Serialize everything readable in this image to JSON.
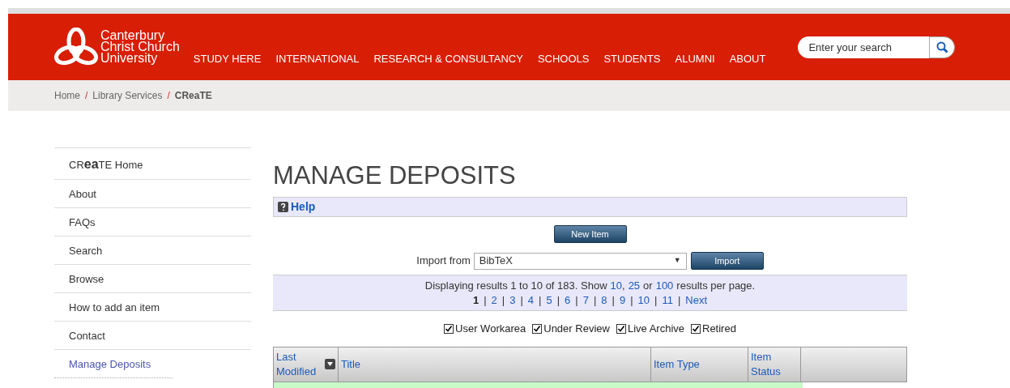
{
  "header": {
    "logo_lines": [
      "Canterbury",
      "Christ Church",
      "University"
    ],
    "nav": [
      "STUDY HERE",
      "INTERNATIONAL",
      "RESEARCH & CONSULTANCY",
      "SCHOOLS",
      "STUDENTS",
      "ALUMNI",
      "ABOUT"
    ],
    "search": {
      "placeholder": "Enter your search"
    }
  },
  "breadcrumb_separator": "/",
  "breadcrumb": [
    {
      "label": "Home",
      "current": false
    },
    {
      "label": "Library Services",
      "current": false
    },
    {
      "label": "CReaTE",
      "current": true
    }
  ],
  "sidebar": {
    "items": [
      {
        "label": "CR**ea**TE Home",
        "selected": false
      },
      {
        "label": "About",
        "selected": false
      },
      {
        "label": "FAQs",
        "selected": false
      },
      {
        "label": "Search",
        "selected": false
      },
      {
        "label": "Browse",
        "selected": false
      },
      {
        "label": "How to add an item",
        "selected": false
      },
      {
        "label": "Contact",
        "selected": false
      },
      {
        "label": "Manage Deposits",
        "selected": true
      }
    ]
  },
  "main": {
    "title": "MANAGE DEPOSITS",
    "help": "Help",
    "new_item": "New Item",
    "import": {
      "label": "Import from",
      "value": "BibTeX",
      "arrow": "▼",
      "button": "Import"
    },
    "results": {
      "prefix": "Displaying results 1 to 10 of 183. Show",
      "per_page": [
        "10",
        "25",
        "100"
      ],
      "sep": ",",
      "or": "or",
      "suffix": "results per page."
    },
    "page_separator": "|",
    "pages": [
      {
        "label": "1",
        "selected": true
      },
      {
        "label": "2",
        "selected": false
      },
      {
        "label": "3",
        "selected": false
      },
      {
        "label": "4",
        "selected": false
      },
      {
        "label": "5",
        "selected": false
      },
      {
        "label": "6",
        "selected": false
      },
      {
        "label": "7",
        "selected": false
      },
      {
        "label": "8",
        "selected": false
      },
      {
        "label": "9",
        "selected": false
      },
      {
        "label": "10",
        "selected": false
      },
      {
        "label": "11",
        "selected": false
      },
      {
        "label": "Next",
        "selected": false
      }
    ],
    "filters": [
      {
        "label": "User Workarea",
        "checked": true
      },
      {
        "label": "Under Review",
        "checked": true
      },
      {
        "label": "Live Archive",
        "checked": true
      },
      {
        "label": "Retired",
        "checked": true
      }
    ],
    "table": {
      "columns": [
        "Last Modified",
        "Title",
        "Item Type",
        "Item Status"
      ]
    }
  }
}
